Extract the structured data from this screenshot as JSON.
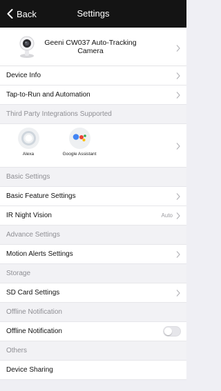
{
  "navbar": {
    "back_label": "Back",
    "title": "Settings"
  },
  "device": {
    "name": "Geeni CW037 Auto-Tracking Camera"
  },
  "rows_top": [
    {
      "label": "Device Info"
    },
    {
      "label": "Tap-to-Run and Automation"
    }
  ],
  "integrations": {
    "header": "Third Party Integrations Supported",
    "items": [
      {
        "label": "Alexa",
        "icon": "alexa-icon"
      },
      {
        "label": "Google Assistant",
        "icon": "google-assistant-icon"
      }
    ]
  },
  "basic": {
    "header": "Basic Settings",
    "feature_label": "Basic Feature Settings",
    "ir_label": "IR Night Vision",
    "ir_value": "Auto"
  },
  "advance": {
    "header": "Advance Settings",
    "motion_label": "Motion Alerts Settings"
  },
  "storage": {
    "header": "Storage",
    "sd_label": "SD Card Settings"
  },
  "offline": {
    "header": "Offline Notification",
    "toggle_label": "Offline Notification",
    "toggle_on": false
  },
  "others": {
    "header": "Others",
    "sharing_label": "Device Sharing"
  },
  "colors": {
    "navbar_bg": "#141414",
    "google_blue": "#4285f4",
    "google_red": "#ea4335",
    "google_yellow": "#fbbc05",
    "google_green": "#34a853"
  }
}
